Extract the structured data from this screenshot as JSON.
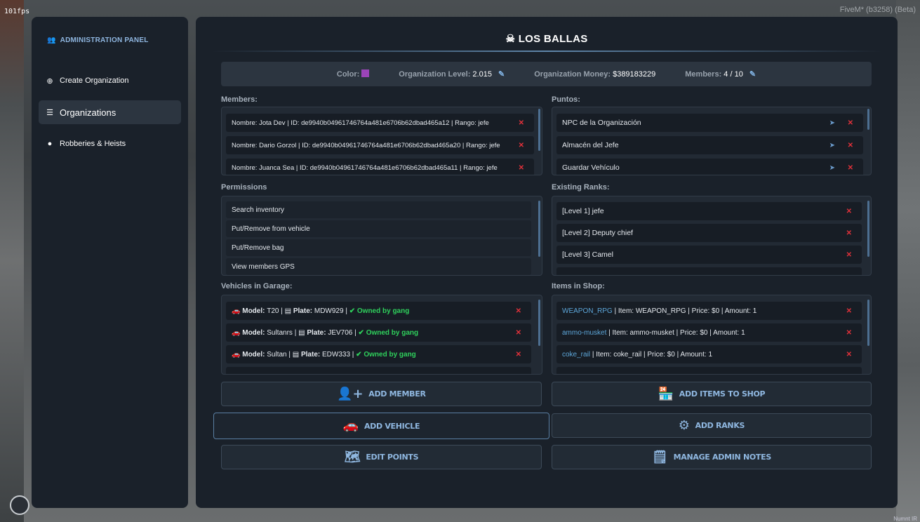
{
  "overlay": {
    "fps": "101fps",
    "build": "FiveM* (b3258) (Beta)",
    "bottom_tag": "Numnt IR"
  },
  "sidebar": {
    "title": "ADMINISTRATION PANEL",
    "items": [
      {
        "label": "Create Organization",
        "icon": "plus-circle-icon"
      },
      {
        "label": "Organizations",
        "icon": "list-icon"
      },
      {
        "label": "Robberies & Heists",
        "icon": "money-bag-icon"
      }
    ]
  },
  "header": {
    "title": "LOS BALLAS",
    "icon": "skull-icon"
  },
  "info": {
    "color_label": "Color:",
    "color_value": "#9b44b8",
    "level_label": "Organization Level:",
    "level_value": "2.015",
    "money_label": "Organization Money:",
    "money_value": "$389183229",
    "members_label": "Members:",
    "members_value": "4 / 10"
  },
  "members": {
    "label": "Members:",
    "rows": [
      "Nombre: Jota Dev | ID: de9940b04961746764a481e6706b62dbad465a12 | Rango: jefe",
      "Nombre: Dario Gorzol | ID: de9940b04961746764a481e6706b62dbad465a20 | Rango: jefe",
      "Nombre: Juanca Sea | ID: de9940b04961746764a481e6706b62dbad465a11 | Rango: jefe"
    ]
  },
  "points": {
    "label": "Puntos:",
    "rows": [
      "NPC de la Organización",
      "Almacén del Jefe",
      "Guardar Vehículo"
    ]
  },
  "permissions": {
    "label": "Permissions",
    "rows": [
      "Search inventory",
      "Put/Remove from vehicle",
      "Put/Remove bag",
      "View members GPS"
    ]
  },
  "ranks": {
    "label": "Existing Ranks:",
    "rows": [
      "[Level 1] jefe",
      "[Level 2] Deputy chief",
      "[Level 3] Camel"
    ]
  },
  "vehicles": {
    "label": "Vehicles in Garage:",
    "model_label": "Model:",
    "plate_label": "Plate:",
    "owned_label": "Owned by gang",
    "rows": [
      {
        "model": "T20",
        "plate": "MDW929"
      },
      {
        "model": "Sultanrs",
        "plate": "JEV706"
      },
      {
        "model": "Sultan",
        "plate": "EDW333"
      }
    ]
  },
  "shop": {
    "label": "Items in Shop:",
    "rows": [
      {
        "name": "WEAPON_RPG",
        "detail": "| Item: WEAPON_RPG | Price: $0 | Amount: 1"
      },
      {
        "name": "ammo-musket",
        "detail": "| Item: ammo-musket | Price: $0 | Amount: 1"
      },
      {
        "name": "coke_rail",
        "detail": "| Item: coke_rail | Price: $0 | Amount: 1"
      }
    ]
  },
  "buttons": {
    "add_member": "ADD MEMBER",
    "add_items": "ADD ITEMS TO SHOP",
    "add_vehicle": "ADD VEHICLE",
    "add_ranks": "ADD RANKS",
    "edit_points": "EDIT POINTS",
    "admin_notes": "MANAGE ADMIN NOTES"
  },
  "colors": {
    "accent": "#8fb7e0",
    "panel": "#1a212a",
    "danger": "#e0313a",
    "success": "#2fd05c"
  }
}
